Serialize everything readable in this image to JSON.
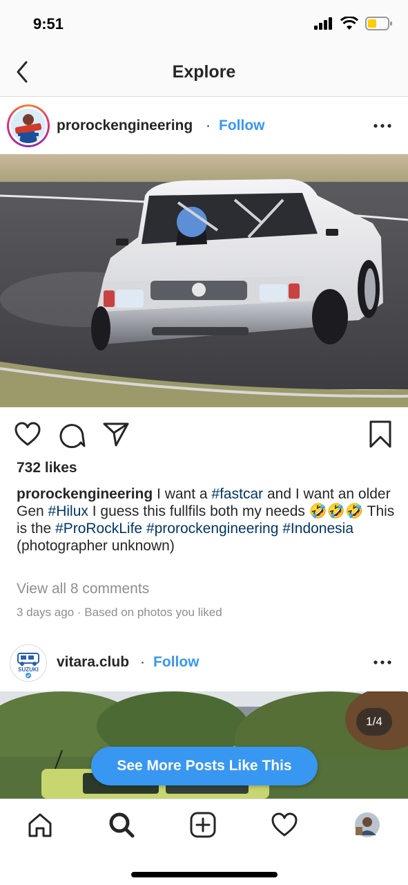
{
  "status_bar": {
    "time": "9:51"
  },
  "header": {
    "title": "Explore"
  },
  "post1": {
    "username": "prorockengineering",
    "separator": "·",
    "follow_label": "Follow",
    "likes": "732 likes",
    "caption": {
      "username": "prorockengineering",
      "t1": " I want a ",
      "tag1": "#fastcar",
      "t2": " and I want an older Gen ",
      "tag2": "#Hilux",
      "t3": " I guess this fullfils both my needs ",
      "emoji": "🤣🤣🤣",
      "t4": " This is the ",
      "tag3": "#ProRockLife",
      "t5": " ",
      "tag4": "#prorockengineering",
      "t6": " ",
      "tag5": "#Indonesia",
      "t7": " (photographer unknown)"
    },
    "view_comments": "View all 8 comments",
    "timestamp": "3 days ago · Based on photos you liked"
  },
  "post2": {
    "username": "vitara.club",
    "separator": "·",
    "follow_label": "Follow",
    "avatar_text": "SUZUKI",
    "image_counter": "1/4"
  },
  "cta": {
    "label": "See More Posts Like This"
  },
  "tabbar": {
    "items": [
      {
        "name": "home",
        "icon": "home-icon"
      },
      {
        "name": "search",
        "icon": "search-icon"
      },
      {
        "name": "new-post",
        "icon": "add-icon"
      },
      {
        "name": "activity",
        "icon": "heart-icon"
      },
      {
        "name": "profile",
        "icon": "avatar"
      }
    ]
  },
  "colors": {
    "link": "#3897f0",
    "hashtag": "#003569",
    "muted": "#8e8e8e",
    "text": "#262626"
  }
}
